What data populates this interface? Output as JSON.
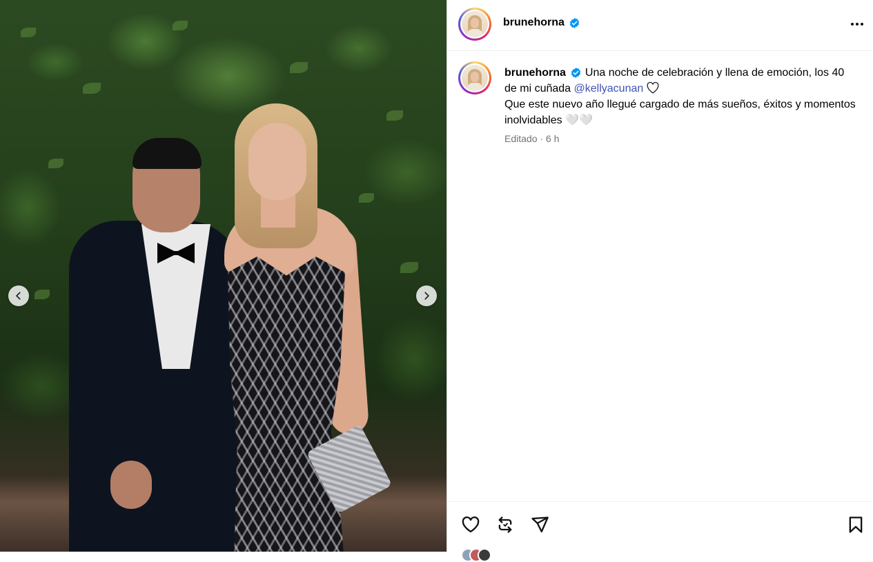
{
  "post": {
    "username": "brunehorna",
    "verified_icon": "verified-badge-icon",
    "caption_line1": "Una noche de celebración y llena de emoción, los 40 de mi cuñada",
    "mention": "@kellyacunan",
    "caption_line2": "Que este nuevo año llegué cargado de más sueños, éxitos y momentos inolvidables 🤍🤍",
    "meta": "Editado · 6 h"
  },
  "photo": {
    "prev_icon": "chevron-left-icon",
    "next_icon": "chevron-right-icon"
  },
  "actions": {
    "like_icon": "heart-icon",
    "repost_icon": "repost-icon",
    "share_icon": "share-icon",
    "save_icon": "bookmark-icon"
  },
  "colors": {
    "mention": "#3f51b5",
    "meta_text": "#737373",
    "verified": "#0095f6",
    "divider": "#dbdbdb"
  }
}
